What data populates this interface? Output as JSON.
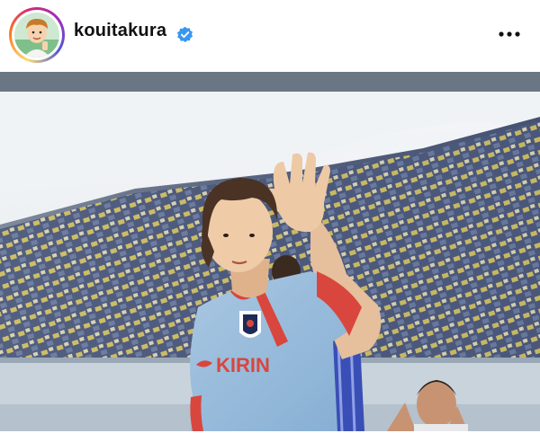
{
  "post": {
    "username": "kouitakura",
    "verified": true,
    "avatar_icon": "cartoon-avatar-icon",
    "verified_icon": "verified-badge-icon",
    "more_icon": "more-options-icon",
    "jersey_sponsor_text": "KIRIN",
    "accent_color": "#3897f0"
  }
}
